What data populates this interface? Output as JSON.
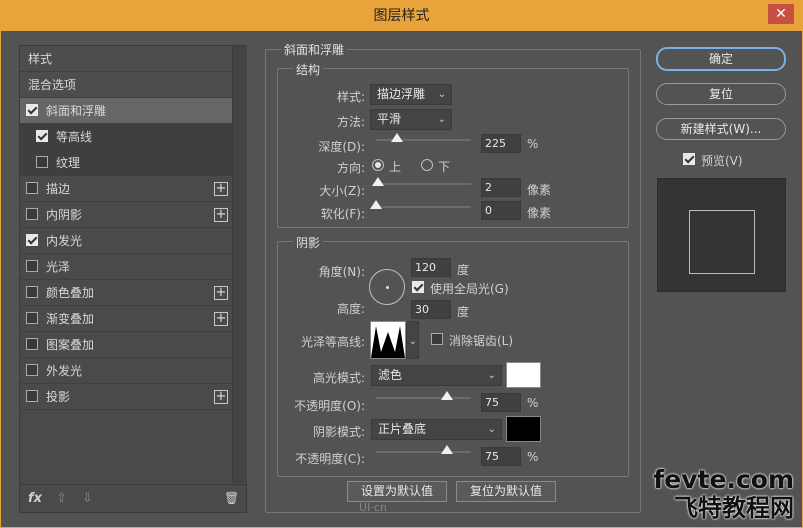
{
  "window": {
    "title": "图层样式",
    "close": "✕"
  },
  "left_panel": {
    "header": "样式",
    "blend": "混合选项",
    "items": [
      {
        "label": "斜面和浮雕",
        "checked": true
      },
      {
        "label": "等高线",
        "checked": true
      },
      {
        "label": "纹理",
        "checked": false
      },
      {
        "label": "描边",
        "checked": false
      },
      {
        "label": "内阴影",
        "checked": false
      },
      {
        "label": "内发光",
        "checked": true
      },
      {
        "label": "光泽",
        "checked": false
      },
      {
        "label": "颜色叠加",
        "checked": false
      },
      {
        "label": "渐变叠加",
        "checked": false
      },
      {
        "label": "图案叠加",
        "checked": false
      },
      {
        "label": "外发光",
        "checked": false
      },
      {
        "label": "投影",
        "checked": false
      }
    ],
    "footer": {
      "fx": "fx",
      "up": "⇧",
      "down": "⇩",
      "trash": "🗑"
    }
  },
  "bevel": {
    "title": "斜面和浮雕",
    "structure": {
      "title": "结构",
      "style_label": "样式:",
      "style_value": "描边浮雕",
      "method_label": "方法:",
      "method_value": "平滑",
      "depth_label": "深度(D):",
      "depth_value": "225",
      "depth_unit": "%",
      "depth_level": 0.225,
      "direction_label": "方向:",
      "dir_up": "上",
      "dir_down": "下",
      "dir_selected": "上",
      "size_label": "大小(Z):",
      "size_value": "2",
      "size_unit": "像素",
      "size_level": 0.02,
      "soften_label": "软化(F):",
      "soften_value": "0",
      "soften_unit": "像素",
      "soften_level": 0.0
    },
    "shading": {
      "title": "阴影",
      "angle_label": "角度(N):",
      "angle_value": "120",
      "angle_unit": "度",
      "global_light_label": "使用全局光(G)",
      "global_light": true,
      "altitude_label": "高度:",
      "altitude_value": "30",
      "altitude_unit": "度",
      "gloss_label": "光泽等高线:",
      "antialias_label": "消除锯齿(L)",
      "antialias": false,
      "highlight_label": "高光模式:",
      "highlight_mode": "滤色",
      "highlight_color": "#ffffff",
      "hl_opacity_label": "不透明度(O):",
      "hl_opacity_value": "75",
      "hl_opacity_unit": "%",
      "hl_opacity_level": 0.75,
      "shadow_label": "阴影模式:",
      "shadow_mode": "正片叠底",
      "shadow_color": "#000000",
      "sh_opacity_label": "不透明度(C):",
      "sh_opacity_value": "75",
      "sh_opacity_unit": "%",
      "sh_opacity_level": 0.75
    },
    "set_default": "设置为默认值",
    "reset_default": "复位为默认值"
  },
  "right": {
    "ok": "确定",
    "reset": "复位",
    "new_style": "新建样式(W)...",
    "preview_label": "预览(V)",
    "preview": true
  },
  "watermark": {
    "top": "fevte.com",
    "bottom": "飞特教程网",
    "mid": "UI·cn"
  }
}
